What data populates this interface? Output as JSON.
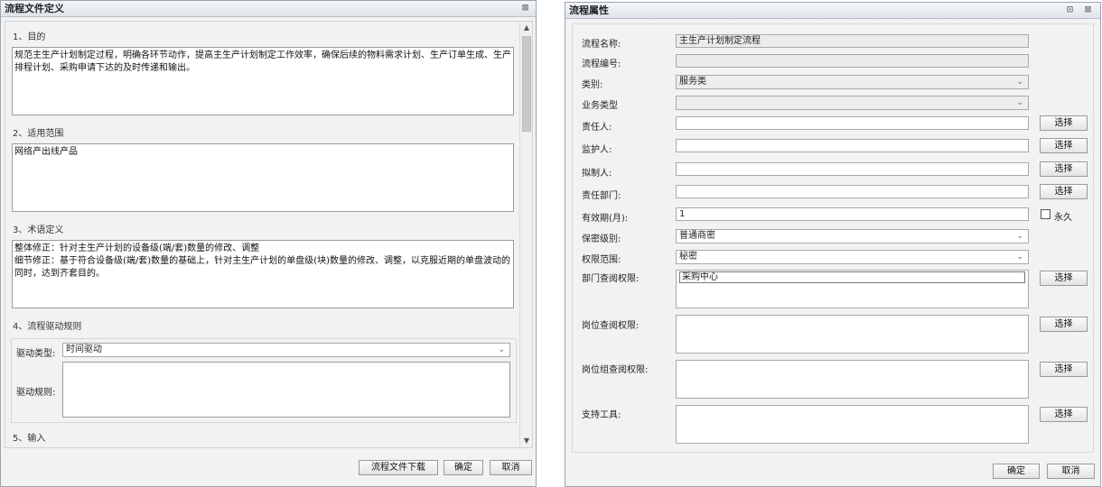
{
  "left_dialog": {
    "title": "流程文件定义",
    "close_glyph": "⊠",
    "sections": {
      "purpose_heading": "1、目的",
      "purpose_text": "规范主生产计划制定过程，明确各环节动作，提高主生产计划制定工作效率，确保后续的物料需求计划、生产订单生成、生产排程计划、采购申请下达的及时传递和输出。",
      "scope_heading": "2、适用范围",
      "scope_text": "网络产出线产品",
      "terms_heading": "3、术语定义",
      "terms_text": "整体修正：针对主生产计划的设备级(端/套)数量的修改、调整\n细节修正：基于符合设备级(端/套)数量的基础上，针对主生产计划的单盘级(块)数量的修改、调整，以克服近期的单盘波动的同时，达到齐套目的。",
      "drive_heading": "4、流程驱动规则",
      "drive_type_label": "驱动类型:",
      "drive_type_value": "时间驱动",
      "drive_rule_label": "驱动规则:",
      "drive_rule_value": "",
      "input_heading": "5、输入"
    },
    "buttons": {
      "download": "流程文件下载",
      "ok": "确定",
      "cancel": "取消"
    }
  },
  "right_dialog": {
    "title": "流程属性",
    "restore_glyph": "⊡",
    "close_glyph": "⊠",
    "fields": {
      "name_label": "流程名称:",
      "name_value": "主生产计划制定流程",
      "number_label": "流程编号:",
      "number_value": "",
      "category_label": "类别:",
      "category_value": "服务类",
      "business_type_label": "业务类型",
      "business_type_value": "",
      "owner_label": "责任人:",
      "owner_value": "",
      "guardian_label": "监护人:",
      "guardian_value": "",
      "drafter_label": "拟制人:",
      "drafter_value": "",
      "dept_label": "责任部门:",
      "dept_value": "",
      "validity_label": "有效期(月):",
      "validity_value": "1",
      "permanent_label": "永久",
      "permanent_checked": false,
      "secrecy_label": "保密级别:",
      "secrecy_value": "普通商密",
      "scope_label": "权限范围:",
      "scope_value": "秘密",
      "dept_perm_label": "部门查阅权限:",
      "dept_perm_value": "采购中心",
      "post_perm_label": "岗位查阅权限:",
      "post_perm_value": "",
      "postgroup_perm_label": "岗位组查阅权限:",
      "postgroup_perm_value": "",
      "tools_label": "支持工具:",
      "tools_value": ""
    },
    "select_button": "选择",
    "buttons": {
      "ok": "确定",
      "cancel": "取消"
    }
  },
  "icons": {
    "chevron": "⌄",
    "scroll_up": "▲",
    "scroll_down": "▼"
  }
}
